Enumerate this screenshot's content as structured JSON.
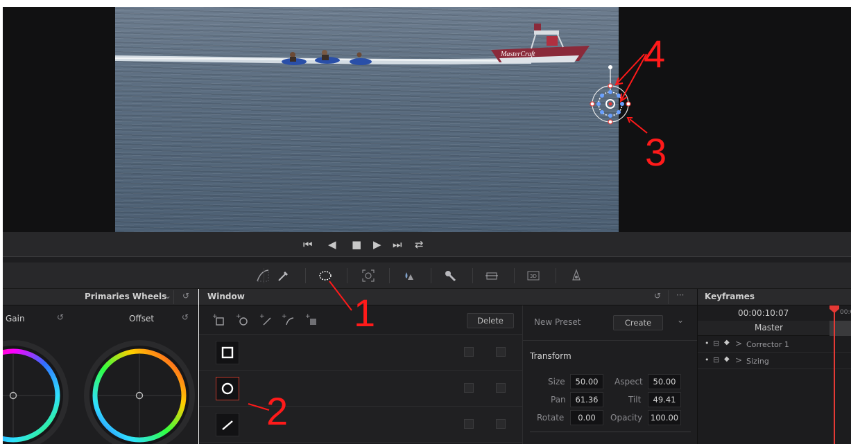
{
  "viewer": {
    "boat_brand": "MasterCraft"
  },
  "transport": {
    "first": "⏮",
    "prev": "◀",
    "stop": "■",
    "play": "▶",
    "last": "⏭",
    "loop": "⇄"
  },
  "tools": [
    {
      "icon": "curves-icon"
    },
    {
      "icon": "qualifier-eyedropper-icon"
    },
    {
      "icon": "window-icon"
    },
    {
      "icon": "tracker-icon"
    },
    {
      "icon": "blur-icon"
    },
    {
      "icon": "key-icon"
    },
    {
      "icon": "sizing-icon"
    },
    {
      "icon": "3d-icon",
      "label": "3D"
    },
    {
      "icon": "magic-mask-icon"
    }
  ],
  "primaries": {
    "title": "Primaries Wheels",
    "gain_label": "Gain",
    "offset_label": "Offset"
  },
  "window": {
    "title": "Window",
    "delete_label": "Delete",
    "new_preset_label": "New Preset",
    "create_label": "Create",
    "transform": {
      "title": "Transform",
      "size_label": "Size",
      "size": "50.00",
      "aspect_label": "Aspect",
      "aspect": "50.00",
      "pan_label": "Pan",
      "pan": "61.36",
      "tilt_label": "Tilt",
      "tilt": "49.41",
      "rotate_label": "Rotate",
      "rotate": "0.00",
      "opacity_label": "Opacity",
      "opacity": "100.00"
    },
    "shapes": [
      {
        "name": "square"
      },
      {
        "name": "circle",
        "selected": true
      },
      {
        "name": "linear"
      }
    ]
  },
  "keyframes": {
    "title": "Keyframes",
    "timecode": "00:00:10:07",
    "ruler_start": "00:0",
    "master_label": "Master",
    "tracks": [
      {
        "label": "Corrector 1"
      },
      {
        "label": "Sizing"
      }
    ]
  },
  "annotations": [
    "1",
    "2",
    "3",
    "4"
  ],
  "colors": {
    "annotation": "#ff1a1a",
    "playhead": "#e53935"
  }
}
